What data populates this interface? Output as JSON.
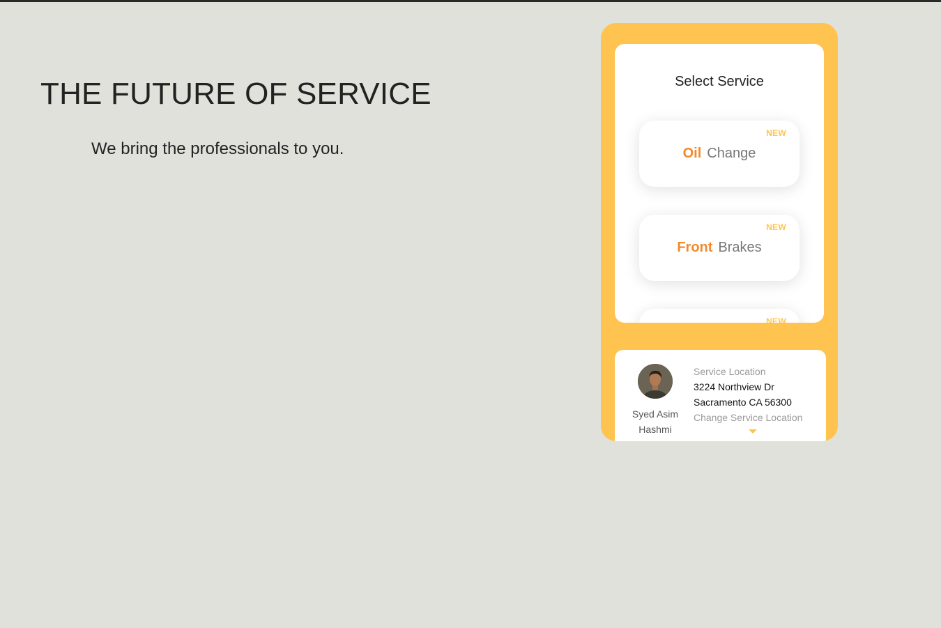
{
  "hero": {
    "title": "THE FUTURE OF SERVICE",
    "subtitle": "We bring the professionals to you."
  },
  "app": {
    "select_title": "Select Service",
    "services": [
      {
        "bold": "Oil",
        "rest": "Change",
        "badge": "NEW"
      },
      {
        "bold": "Front",
        "rest": "Brakes",
        "badge": "NEW"
      },
      {
        "bold": "",
        "rest": "",
        "badge": "NEW"
      }
    ],
    "user": {
      "name": "Syed Asim Hashmi"
    },
    "location": {
      "label": "Service Location",
      "address": "3224 Northview Dr Sacramento CA 56300",
      "change": "Change Service Location"
    }
  },
  "colors": {
    "background": "#e1e1dc",
    "accent_yellow": "#ffc44f",
    "accent_orange": "#f28a2e"
  }
}
